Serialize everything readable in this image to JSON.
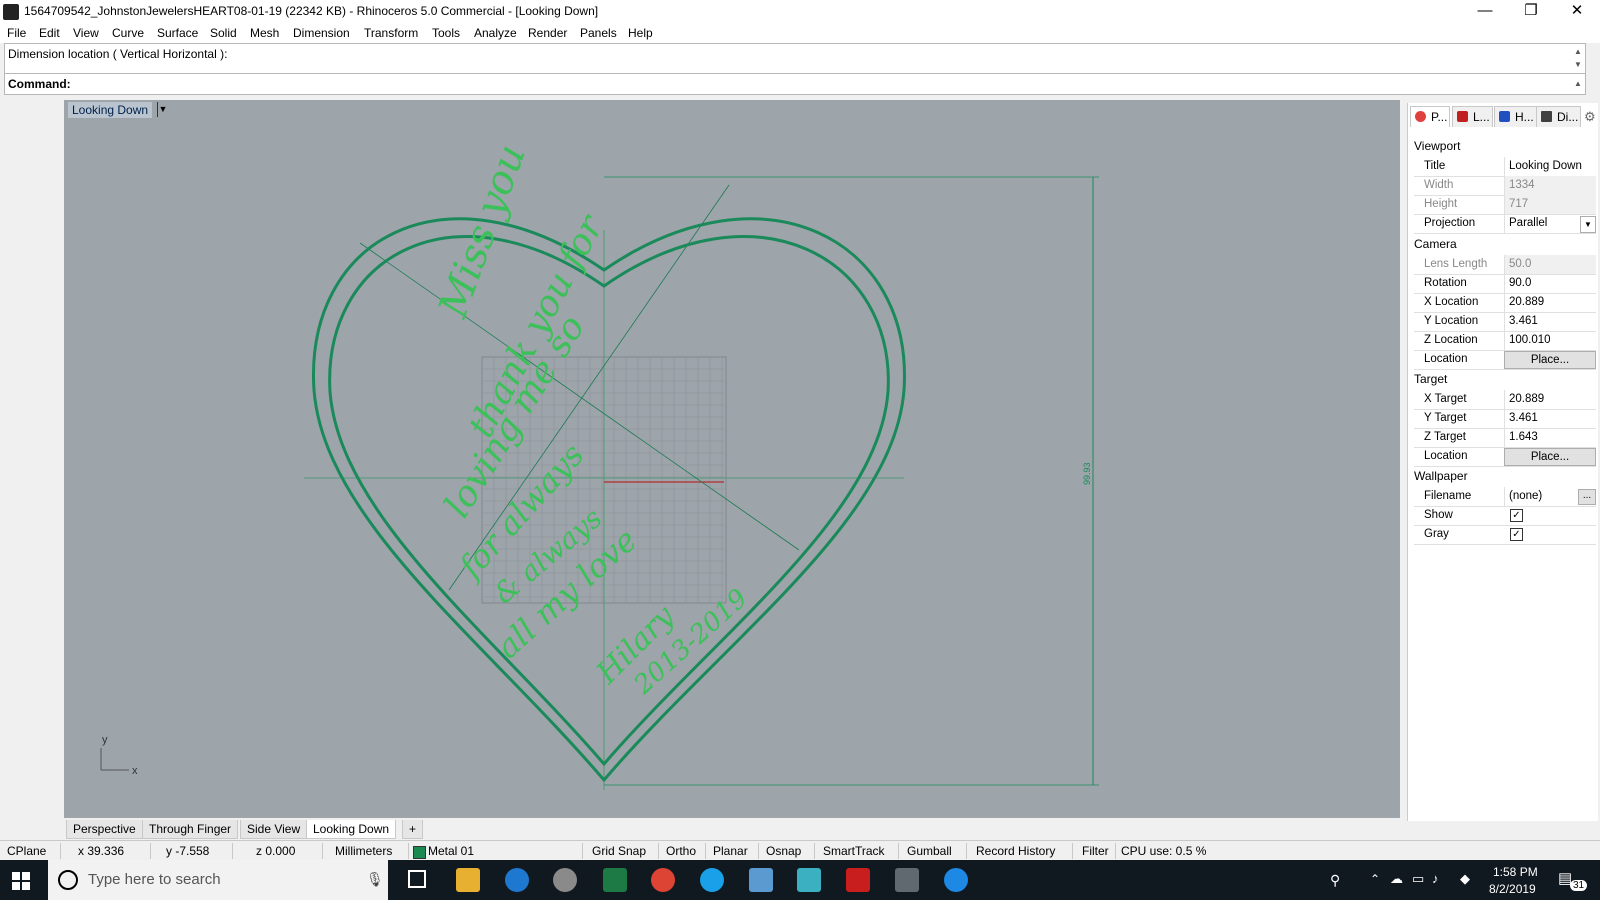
{
  "window": {
    "title": "1564709542_JohnstonJewelersHEART08-01-19 (22342 KB) - Rhinoceros 5.0 Commercial - [Looking Down]",
    "minimize": "—",
    "restore": "❐",
    "close": "✕"
  },
  "menu": [
    "File",
    "Edit",
    "View",
    "Curve",
    "Surface",
    "Solid",
    "Mesh",
    "Dimension",
    "Transform",
    "Tools",
    "Analyze",
    "Render",
    "Panels",
    "Help"
  ],
  "command": {
    "history": "Dimension location ( Vertical  Horizontal ):",
    "label": "Command:",
    "value": ""
  },
  "viewport": {
    "title": "Looking Down",
    "dimension_label": "99.93",
    "axis_y": "y",
    "axis_x": "x",
    "engraving": [
      "Miss you",
      "thank you for",
      "loving me so",
      "for always",
      "& always",
      "all my love",
      "Hilary",
      "2013-2019"
    ]
  },
  "viewport_tabs": [
    "Perspective",
    "Through Finger",
    "Side View",
    "Looking Down",
    "+"
  ],
  "panel": {
    "tabs": [
      "P...",
      "L...",
      "H...",
      "Di..."
    ],
    "sections": {
      "viewport": "Viewport",
      "camera": "Camera",
      "target": "Target",
      "wallpaper": "Wallpaper"
    },
    "viewport_props": {
      "title_label": "Title",
      "title_value": "Looking Down",
      "width_label": "Width",
      "width_value": "1334",
      "height_label": "Height",
      "height_value": "717",
      "projection_label": "Projection",
      "projection_value": "Parallel"
    },
    "camera_props": {
      "lens_label": "Lens Length",
      "lens_value": "50.0",
      "rotation_label": "Rotation",
      "rotation_value": "90.0",
      "xloc_label": "X Location",
      "xloc_value": "20.889",
      "yloc_label": "Y Location",
      "yloc_value": "3.461",
      "zloc_label": "Z Location",
      "zloc_value": "100.010",
      "location_label": "Location",
      "place_label": "Place..."
    },
    "target_props": {
      "xt_label": "X Target",
      "xt_value": "20.889",
      "yt_label": "Y Target",
      "yt_value": "3.461",
      "zt_label": "Z Target",
      "zt_value": "1.643",
      "location_label": "Location",
      "place_label": "Place..."
    },
    "wallpaper_props": {
      "filename_label": "Filename",
      "filename_value": "(none)",
      "browse": "...",
      "show_label": "Show",
      "gray_label": "Gray",
      "check": "✓"
    }
  },
  "status": {
    "cplane": "CPlane",
    "x": "x 39.336",
    "y": "y -7.558",
    "z": "z 0.000",
    "units": "Millimeters",
    "layer": "Metal 01",
    "layer_color": "#1a8a50",
    "toggles": [
      "Grid Snap",
      "Ortho",
      "Planar",
      "Osnap",
      "SmartTrack",
      "Gumball",
      "Record History",
      "Filter"
    ],
    "cpu": "CPU use: 0.5 %"
  },
  "taskbar": {
    "search_placeholder": "Type here to search",
    "time": "1:58 PM",
    "date": "8/2/2019",
    "notifications": "31"
  },
  "colors": {
    "heart_stroke": "#1a8a5a",
    "engraving": "#3cc05a",
    "viewport_bg": "#9da4aa"
  }
}
